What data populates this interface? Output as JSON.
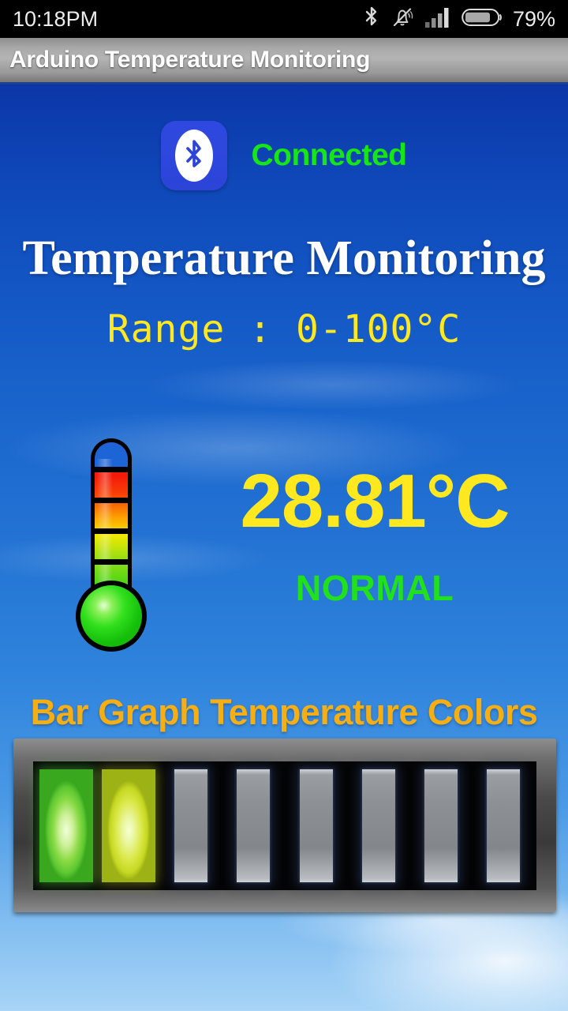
{
  "status_bar": {
    "clock": "10:18PM",
    "battery_percent": "79%",
    "icons": [
      "bluetooth-icon",
      "silent-bell-icon",
      "signal-bars-icon",
      "battery-icon"
    ],
    "battery_level": 79,
    "signal_bars_filled": 3,
    "signal_bars_total": 4
  },
  "action_bar": {
    "title": "Arduino Temperature Monitoring"
  },
  "connection": {
    "status_label": "Connected",
    "status_color": "#16e616",
    "icon": "bluetooth-icon",
    "icon_bg": "#2f49e0"
  },
  "headings": {
    "title": "Temperature Monitoring",
    "title_color": "#ffffff",
    "range": "Range  :  0-100°C",
    "range_color": "#ffe81f"
  },
  "reading": {
    "value": "28.81°C",
    "value_color": "#ffe81f",
    "state": "NORMAL",
    "state_color": "#21e21a"
  },
  "thermometer": {
    "name": "thermometer-gauge",
    "tick_count": 5,
    "gradient_stops": [
      "#f40a0a",
      "#fa4b06",
      "#fba800",
      "#f2e800",
      "#9ade14",
      "#27d615"
    ],
    "bulb_color": "#2ae01c"
  },
  "bargraph": {
    "label": "Bar Graph Temperature Colors",
    "label_color": "#f5ae14",
    "segments_total": 8,
    "segments_lit": 2,
    "segments": [
      {
        "index": 1,
        "state": "on",
        "color": "#5ec832"
      },
      {
        "index": 2,
        "state": "on",
        "color": "#c6d821"
      },
      {
        "index": 3,
        "state": "off",
        "color": "#8d9095"
      },
      {
        "index": 4,
        "state": "off",
        "color": "#8d9095"
      },
      {
        "index": 5,
        "state": "off",
        "color": "#8d9095"
      },
      {
        "index": 6,
        "state": "off",
        "color": "#8d9095"
      },
      {
        "index": 7,
        "state": "off",
        "color": "#8d9095"
      },
      {
        "index": 8,
        "state": "off",
        "color": "#8d9095"
      }
    ]
  }
}
